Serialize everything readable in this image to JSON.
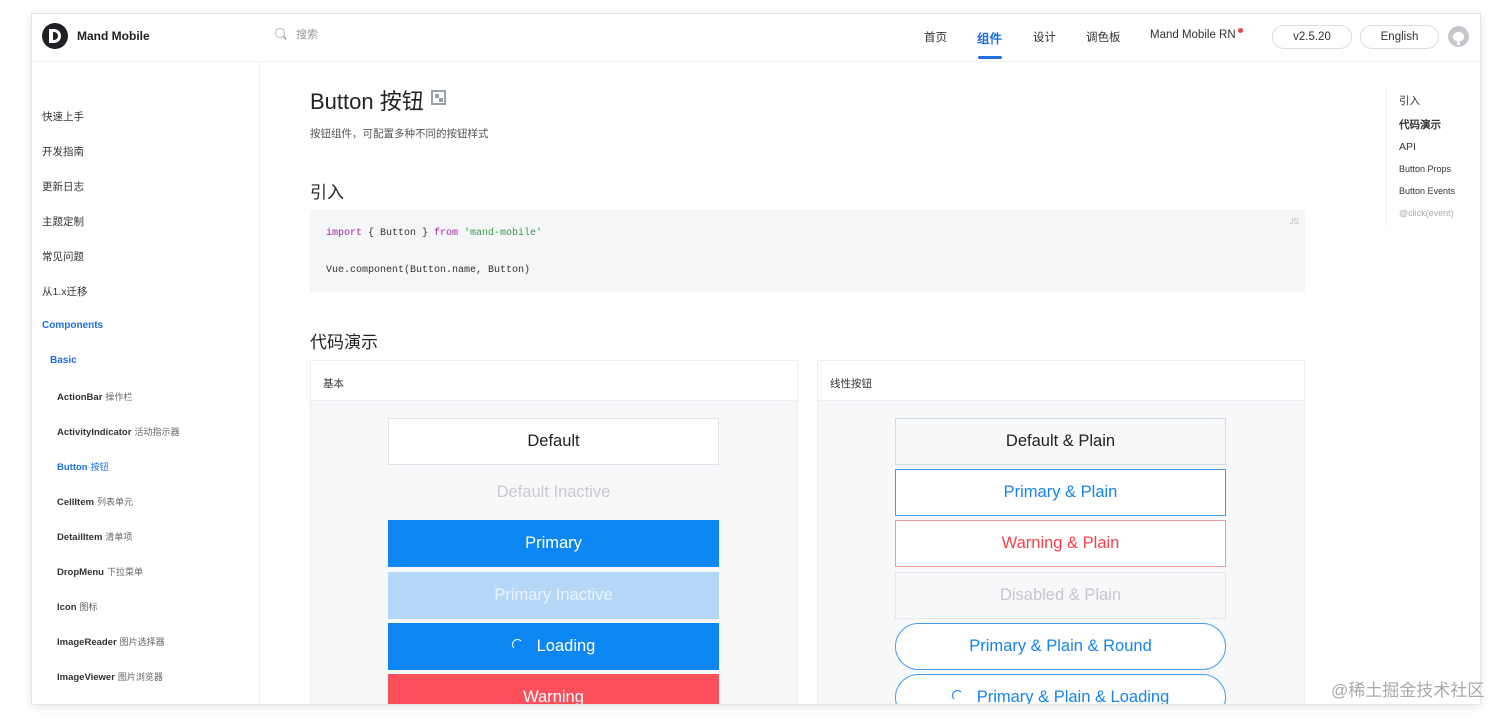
{
  "header": {
    "brand": "Mand Mobile",
    "search_placeholder": "搜索",
    "nav": [
      {
        "label": "首页",
        "active": false
      },
      {
        "label": "组件",
        "active": true
      },
      {
        "label": "设计",
        "active": false
      },
      {
        "label": "调色板",
        "active": false
      },
      {
        "label": "Mand Mobile RN",
        "active": false
      }
    ],
    "version": "v2.5.20",
    "language": "English"
  },
  "sidebar": {
    "items": [
      "快速上手",
      "开发指南",
      "更新日志",
      "主题定制",
      "常见问题",
      "从1.x迁移"
    ],
    "group": "Components",
    "subgroup": "Basic",
    "components": [
      {
        "name": "ActionBar",
        "cn": "操作栏"
      },
      {
        "name": "ActivityIndicator",
        "cn": "活动指示器"
      },
      {
        "name": "Button",
        "cn": "按钮",
        "active": true
      },
      {
        "name": "CellItem",
        "cn": "列表单元"
      },
      {
        "name": "DetailItem",
        "cn": "清单项"
      },
      {
        "name": "DropMenu",
        "cn": "下拉菜单"
      },
      {
        "name": "Icon",
        "cn": "图标"
      },
      {
        "name": "ImageReader",
        "cn": "图片选择器"
      },
      {
        "name": "ImageViewer",
        "cn": "图片浏览器"
      }
    ]
  },
  "main": {
    "title": "Button 按钮",
    "description": "按钮组件，可配置多种不同的按钮样式",
    "import_heading": "引入",
    "code": {
      "lang": "JS",
      "line1": {
        "kw1": "import",
        "mid": " { Button } ",
        "kw2": "from",
        "str": " 'mand-mobile'"
      },
      "line2": "Vue.component(Button.name, Button)"
    },
    "demo_heading": "代码演示",
    "demos": [
      {
        "title": "基本",
        "buttons": [
          "Default",
          "Default Inactive",
          "Primary",
          "Primary Inactive",
          "Loading",
          "Warning"
        ]
      },
      {
        "title": "线性按钮",
        "buttons": [
          "Default & Plain",
          "Primary & Plain",
          "Warning & Plain",
          "Disabled & Plain",
          "Primary & Plain & Round",
          "Primary & Plain & Loading"
        ]
      }
    ]
  },
  "toc": [
    "引入",
    "代码演示",
    "API",
    "Button Props",
    "Button Events",
    "@click(event)"
  ],
  "watermark": "@稀土掘金技术社区",
  "colors": {
    "accent": "#1f6fe0",
    "primary": "#0b86f2",
    "warning": "#fb4f5b"
  }
}
